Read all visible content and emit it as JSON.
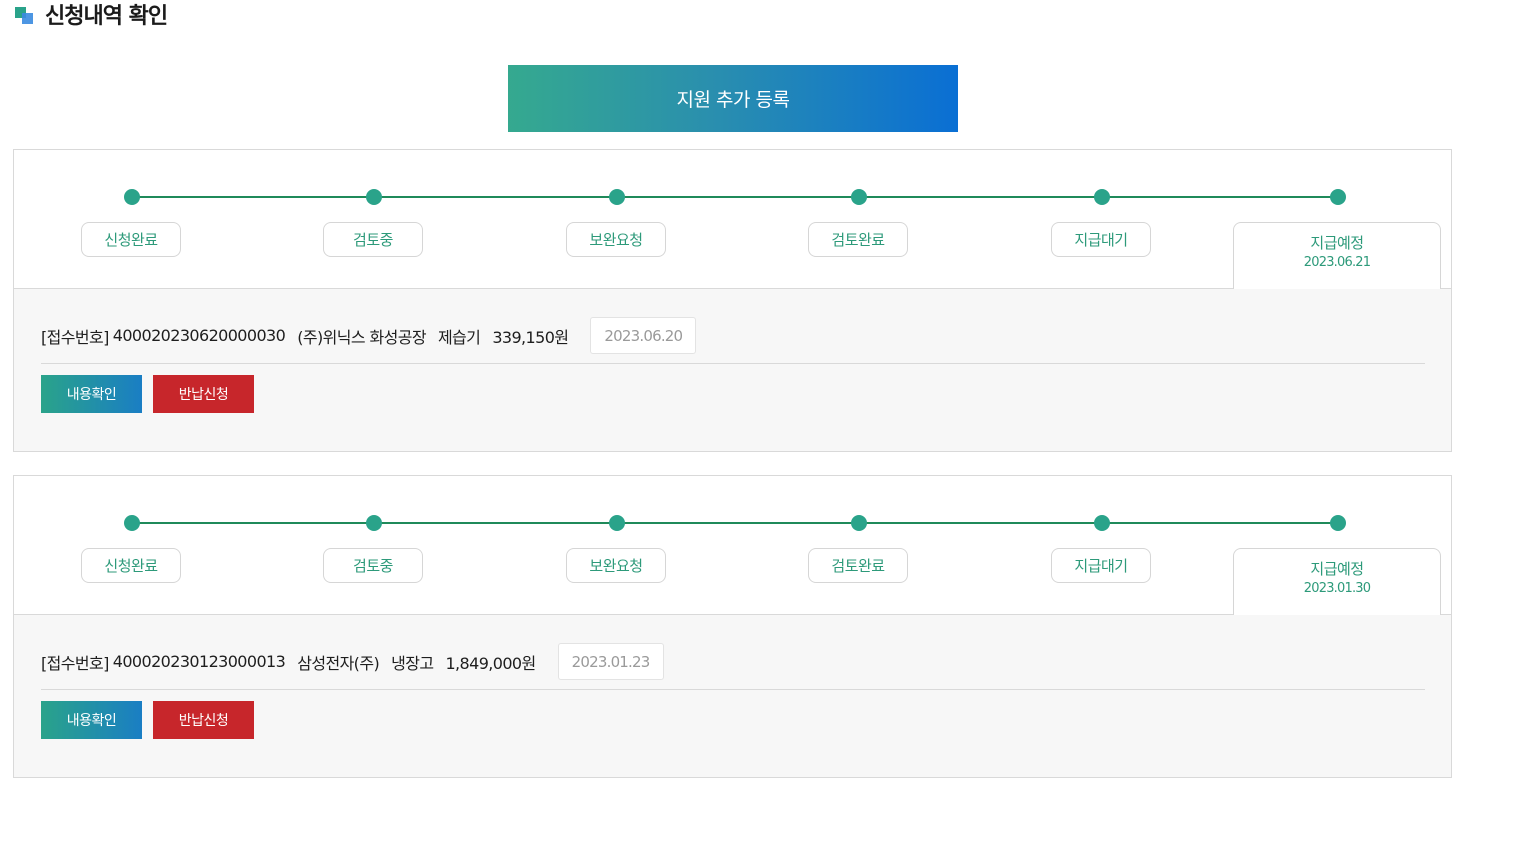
{
  "header": {
    "title": "신청내역 확인"
  },
  "add_button_label": "지원 추가 등록",
  "applications": [
    {
      "steps": [
        "신청완료",
        "검토중",
        "보완요청",
        "검토완료",
        "지급대기"
      ],
      "current_step": {
        "label": "지급예정",
        "date": "2023.06.21"
      },
      "receipt_prefix": "[접수번호]",
      "receipt_number": "400020230620000030",
      "company": "(주)위닉스 화성공장",
      "product": "제습기",
      "amount": "339,150원",
      "date": "2023.06.20",
      "view_button": "내용확인",
      "return_button": "반납신청"
    },
    {
      "steps": [
        "신청완료",
        "검토중",
        "보완요청",
        "검토완료",
        "지급대기"
      ],
      "current_step": {
        "label": "지급예정",
        "date": "2023.01.30"
      },
      "receipt_prefix": "[접수번호]",
      "receipt_number": "400020230123000013",
      "company": "삼성전자(주)",
      "product": "냉장고",
      "amount": "1,849,000원",
      "date": "2023.01.23",
      "view_button": "내용확인",
      "return_button": "반납신청"
    }
  ]
}
